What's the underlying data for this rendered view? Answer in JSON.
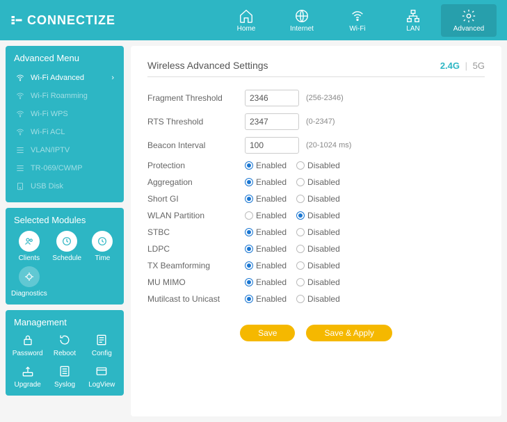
{
  "brand": "CONNECTIZE",
  "nav": [
    {
      "label": "Home"
    },
    {
      "label": "Internet"
    },
    {
      "label": "Wi-Fi"
    },
    {
      "label": "LAN"
    },
    {
      "label": "Advanced"
    }
  ],
  "sidebar": {
    "advanced_title": "Advanced Menu",
    "items": [
      {
        "label": "Wi-Fi Advanced",
        "active": true
      },
      {
        "label": "Wi-Fi Roamming"
      },
      {
        "label": "Wi-Fi WPS"
      },
      {
        "label": "Wi-Fi ACL"
      },
      {
        "label": "VLAN/IPTV"
      },
      {
        "label": "TR-069/CWMP"
      },
      {
        "label": "USB Disk"
      }
    ],
    "modules_title": "Selected Modules",
    "modules": [
      {
        "label": "Clients"
      },
      {
        "label": "Schedule"
      },
      {
        "label": "Time"
      },
      {
        "label": "Diagnostics"
      }
    ],
    "management_title": "Management",
    "management": [
      {
        "label": "Password"
      },
      {
        "label": "Reboot"
      },
      {
        "label": "Config"
      },
      {
        "label": "Upgrade"
      },
      {
        "label": "Syslog"
      },
      {
        "label": "LogView"
      }
    ]
  },
  "page": {
    "title": "Wireless Advanced Settings",
    "bands": {
      "b24": "2.4G",
      "b5": "5G"
    },
    "fields": {
      "fragment": {
        "label": "Fragment Threshold",
        "value": "2346",
        "hint": "(256-2346)"
      },
      "rts": {
        "label": "RTS Threshold",
        "value": "2347",
        "hint": "(0-2347)"
      },
      "beacon": {
        "label": "Beacon Interval",
        "value": "100",
        "hint": "(20-1024 ms)"
      }
    },
    "radio_labels": {
      "enabled": "Enabled",
      "disabled": "Disabled"
    },
    "radios": [
      {
        "label": "Protection",
        "value": "enabled"
      },
      {
        "label": "Aggregation",
        "value": "enabled"
      },
      {
        "label": "Short GI",
        "value": "enabled"
      },
      {
        "label": "WLAN Partition",
        "value": "disabled"
      },
      {
        "label": "STBC",
        "value": "enabled"
      },
      {
        "label": "LDPC",
        "value": "enabled"
      },
      {
        "label": "TX Beamforming",
        "value": "enabled"
      },
      {
        "label": "MU MIMO",
        "value": "enabled"
      },
      {
        "label": "Mutilcast to Unicast",
        "value": "enabled"
      }
    ],
    "buttons": {
      "save": "Save",
      "save_apply": "Save & Apply"
    }
  }
}
